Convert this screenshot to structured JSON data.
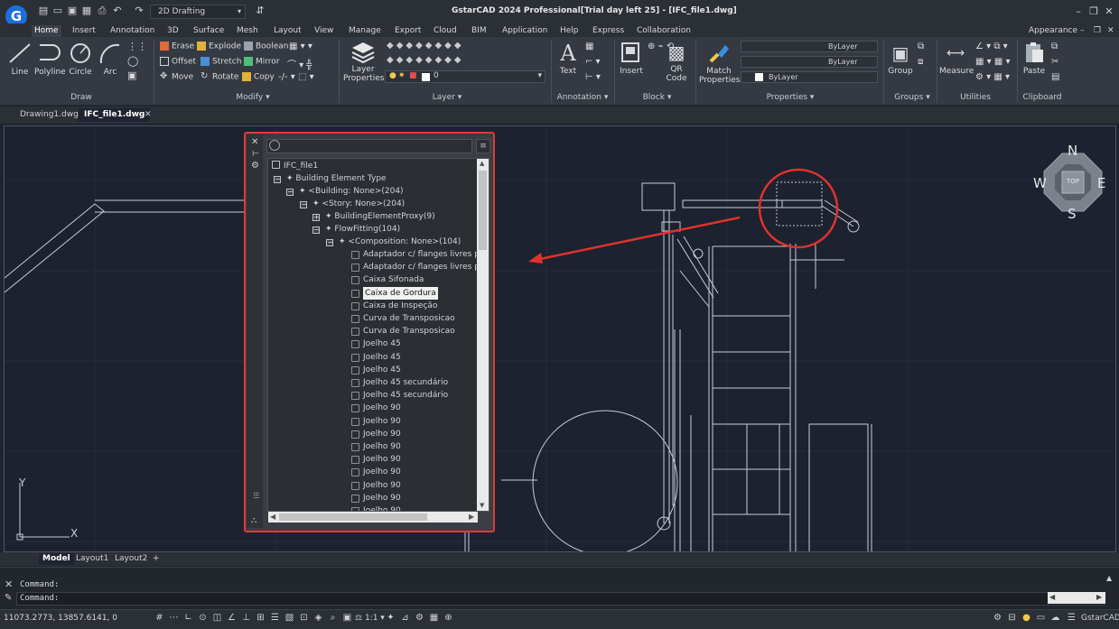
{
  "app": {
    "title": "GstarCAD 2024 Professional[Trial day left 25] - [IFC_file1.dwg]",
    "logo_letter": "G",
    "workspace": "2D Drafting",
    "appearance": "Appearance"
  },
  "menu": [
    "Home",
    "Insert",
    "Annotation",
    "3D",
    "Surface",
    "Mesh",
    "Layout",
    "View",
    "Manage",
    "Export",
    "Cloud",
    "BIM",
    "Application",
    "Help",
    "Express",
    "Collaboration"
  ],
  "ribbon": {
    "draw": {
      "label": "Draw",
      "items": [
        "Line",
        "Polyline",
        "Circle",
        "Arc"
      ]
    },
    "modify": {
      "label": "Modify",
      "rows": [
        [
          "Erase",
          "Explode",
          "Boolean"
        ],
        [
          "Offset",
          "Stretch",
          "Mirror"
        ],
        [
          "Move",
          "Rotate",
          "Copy"
        ]
      ]
    },
    "layer": {
      "label": "Layer",
      "button": [
        "Layer",
        "Properties"
      ],
      "current": "0"
    },
    "annotation": {
      "label": "Annotation",
      "button": "Text"
    },
    "block": {
      "label": "Block",
      "insert": "Insert",
      "qr": [
        "QR",
        "Code"
      ]
    },
    "properties": {
      "label": "Properties",
      "match": [
        "Match",
        "Properties"
      ],
      "bylayer1": "ByLayer",
      "bylayer2": "ByLayer",
      "bylayer3": "ByLayer"
    },
    "groups": {
      "label": "Groups",
      "button": "Group"
    },
    "utilities": {
      "label": "Utilities",
      "button": "Measure"
    },
    "clipboard": {
      "label": "Clipboard",
      "button": "Paste"
    }
  },
  "doctabs": [
    "Drawing1.dwg",
    "IFC_file1.dwg"
  ],
  "viewcube": {
    "n": "N",
    "s": "S",
    "e": "E",
    "w": "W",
    "top": "TOP"
  },
  "ucs": {
    "x": "X",
    "y": "Y"
  },
  "tree": {
    "root": "IFC_file1",
    "type": "Building Element Type",
    "building": "<Building: None>(204)",
    "story": "<Story: None>(204)",
    "proxy": "BuildingElementProxy(9)",
    "flowfitting": "FlowFitting(104)",
    "composition": "<Composition: None>(104)",
    "leaves": [
      "Adaptador c/ flanges livres p...",
      "Adaptador c/ flanges livres p...",
      "Caixa Sifonada",
      "Caixa de Gordura",
      "Caixa de Inspeção",
      "Curva de Transposicao",
      "Curva de Transposicao",
      "Joelho 45",
      "Joelho 45",
      "Joelho 45",
      "Joelho 45 secundário",
      "Joelho 45 secundário",
      "Joelho 90",
      "Joelho 90",
      "Joelho 90",
      "Joelho 90",
      "Joelho 90",
      "Joelho 90",
      "Joelho 90",
      "Joelho 90",
      "Joelho 90"
    ],
    "selected_index": 3
  },
  "layouttabs": [
    "Model",
    "Layout1",
    "Layout2",
    "+"
  ],
  "command": {
    "line1": "Command:",
    "line2": "Command:"
  },
  "status": {
    "coords": "11073.2773, 13857.6141, 0",
    "scale": "1:1",
    "brand": "GstarCAD"
  }
}
